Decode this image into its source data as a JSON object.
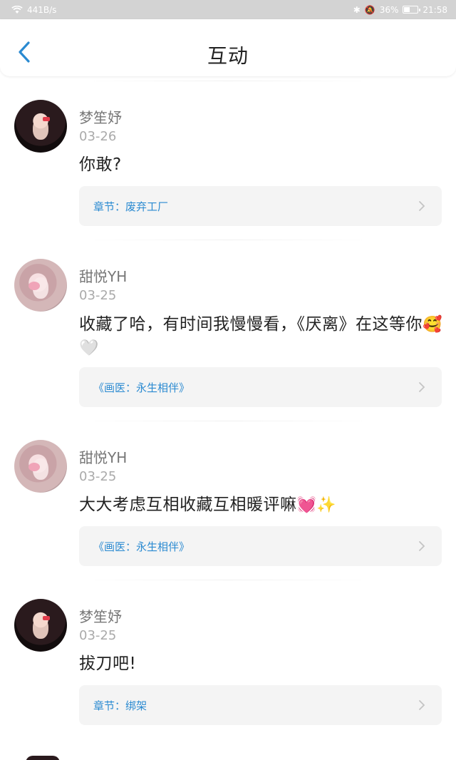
{
  "status_bar": {
    "network_speed": "441B/s",
    "battery_percent": "36%",
    "time": "21:58"
  },
  "header": {
    "title": "互动",
    "back_icon": "chevron-left-icon",
    "accent_color": "#2a8ad1"
  },
  "feed": [
    {
      "username": "梦笙妤",
      "date": "03-26",
      "content": "你敢?",
      "emoji": "",
      "ref": "章节：废弃工厂"
    },
    {
      "username": "甜悦YH",
      "date": "03-25",
      "content": "收藏了哈，有时间我慢慢看，《厌离》在这等你",
      "emoji": "🥰🤍",
      "ref": "《画医：永生相伴》"
    },
    {
      "username": "甜悦YH",
      "date": "03-25",
      "content": "大大考虑互相收藏互相暖评嘛",
      "emoji": "💓✨",
      "ref": "《画医：永生相伴》"
    },
    {
      "username": "梦笙妤",
      "date": "03-25",
      "content": "拔刀吧!",
      "emoji": "",
      "ref": "章节：绑架"
    }
  ]
}
